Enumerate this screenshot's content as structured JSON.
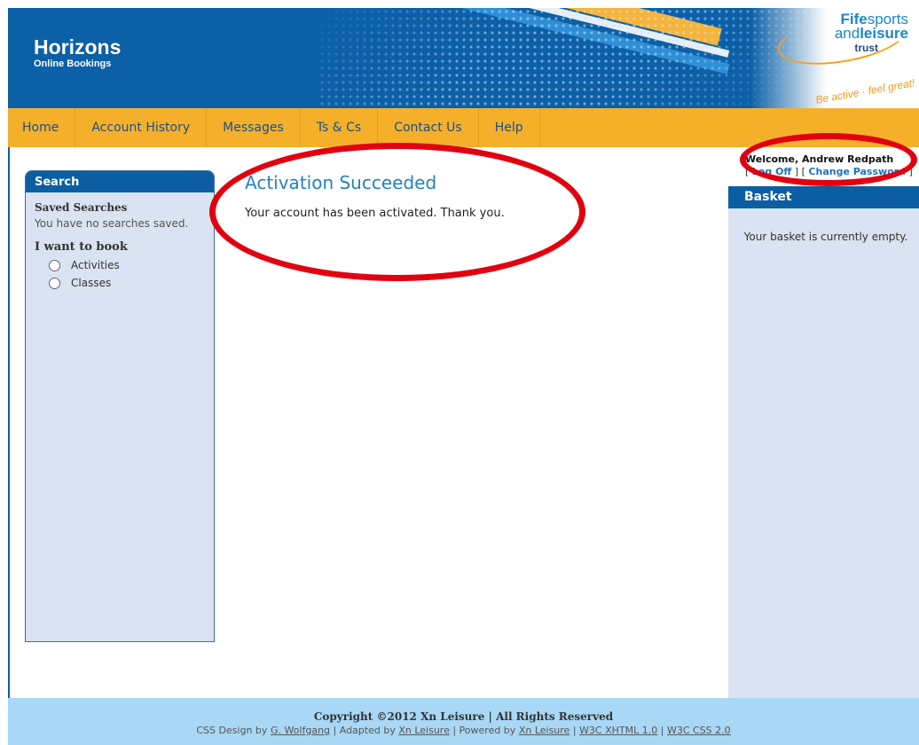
{
  "brand": {
    "title": "Horizons",
    "subtitle": "Online Bookings"
  },
  "partner": {
    "line1_bold": "Fife",
    "line1_text": "sports",
    "line2_text": "and",
    "line2_bold": "leisure",
    "line3": "trust",
    "tagline": "Be active · feel great!"
  },
  "nav": {
    "items": [
      "Home",
      "Account History",
      "Messages",
      "Ts & Cs",
      "Contact Us",
      "Help"
    ]
  },
  "search": {
    "heading": "Search",
    "saved_title": "Saved Searches",
    "saved_text": "You have no searches saved.",
    "book_title": "I want to book",
    "options": [
      "Activities",
      "Classes"
    ]
  },
  "main": {
    "title": "Activation Succeeded",
    "message": "Your account has been activated. Thank you."
  },
  "account": {
    "welcome": "Welcome, Andrew Redpath",
    "logoff": "Log Off",
    "change_password": "Change Password"
  },
  "basket": {
    "heading": "Basket",
    "empty_text": "Your basket is currently empty."
  },
  "footer": {
    "copyright": "Copyright ©2012 Xn Leisure | All Rights Reserved",
    "css_design_prefix": "CSS Design by",
    "designer": "G. Wolfgang",
    "adapted_prefix": "| Adapted by",
    "adapted_by": "Xn Leisure",
    "powered_prefix": "| Powered by",
    "powered_by": "Xn Leisure",
    "sep": "|",
    "xhtml": "W3C XHTML 1.0",
    "css": "W3C CSS 2.0"
  },
  "colors": {
    "header_blue": "#0c60a7",
    "nav_orange": "#f5b02a",
    "panel_blue": "#d9e3f1",
    "annotation_red": "#e10010",
    "title_blue": "#2580c3"
  }
}
